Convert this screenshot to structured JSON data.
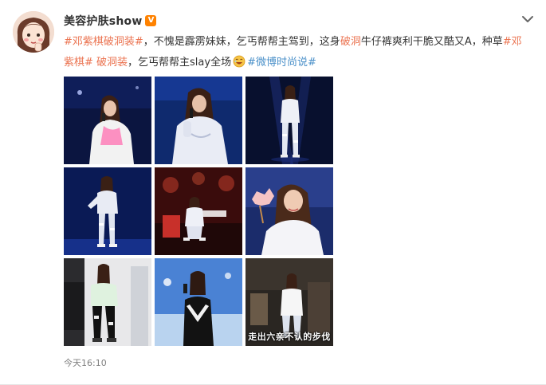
{
  "post": {
    "author": "美容护肤show",
    "verified_badge": "V",
    "timestamp": "今天16:10",
    "text": {
      "tag1": "#邓紫棋破洞装#",
      "seg1": "，不愧是霹雳妹妹，乞丐帮帮主驾到，这身",
      "highlight": "破洞",
      "seg2": "牛仔裤爽利干脆又酷又A，种草",
      "tag2": "#邓紫棋# 破洞装",
      "seg3": "，乞丐帮帮主slay全场",
      "topic": "#微博时尚说#"
    },
    "image_caption": "走出六亲不认的步伐"
  },
  "icons": {
    "more": "chevron-down-icon",
    "emoji": "laugh-emoji-icon"
  },
  "colors": {
    "tag": "#eb7350",
    "topic": "#4a90c9",
    "badge": "#ff8200"
  }
}
